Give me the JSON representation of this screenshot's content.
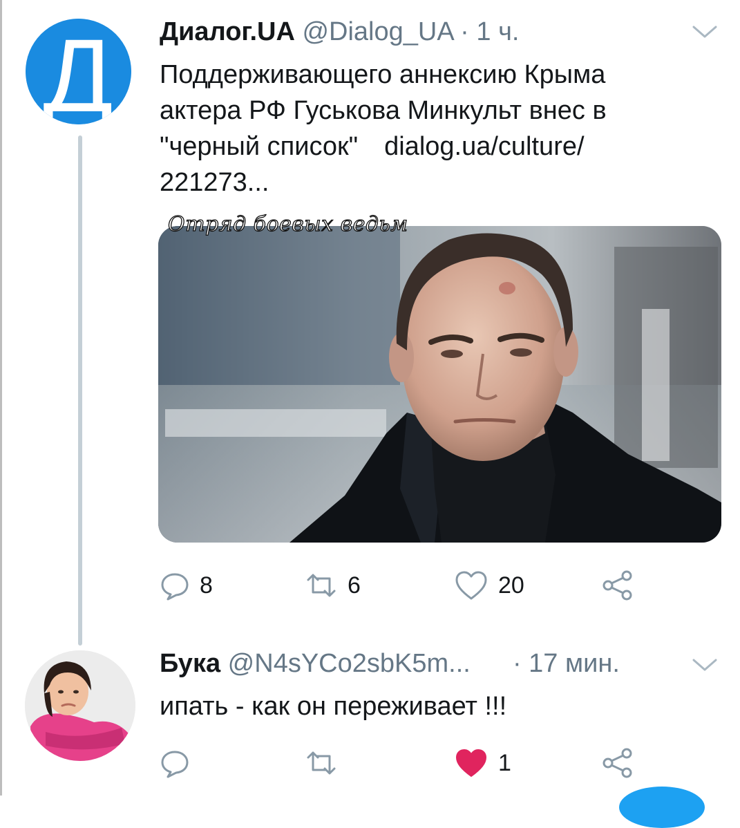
{
  "tweets": [
    {
      "name": "Диалог.UA",
      "handle": "@Dialog_UA",
      "separator": "·",
      "time": "1 ч.",
      "avatar_letter": "Д",
      "text_lines": [
        "Поддерживающего аннексию Крыма",
        "актера РФ Гуськова Минкульт внес в",
        "\"черный список\"",
        "221273..."
      ],
      "link_text": "dialog.ua/culture/",
      "media_watermark": "Отряд боевых ведьм",
      "replies": "8",
      "retweets": "6",
      "likes": "20"
    },
    {
      "name": "Бука",
      "handle": "@N4sYCo2sbK5m...",
      "separator": "·",
      "time": "17 мин.",
      "text": "ипать - как он переживает !!!",
      "likes": "1"
    }
  ],
  "icons": {
    "reply": "reply-icon",
    "retweet": "retweet-icon",
    "like": "heart-icon",
    "like_active": "heart-filled-icon",
    "share": "share-icon",
    "menu": "chevron-down-icon"
  },
  "colors": {
    "avatar_blue": "#1a8be0",
    "text": "#14171a",
    "muted": "#657786",
    "like_red": "#e0245e",
    "thread_line": "#c4cfd6"
  }
}
